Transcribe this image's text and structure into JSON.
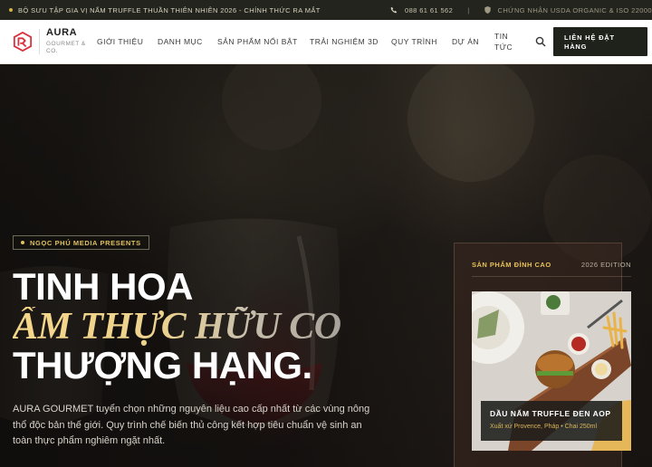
{
  "topbar": {
    "announcement": "BỘ SƯU TẬP GIA VỊ NẤM TRUFFLE THUẦN THIÊN NHIÊN 2026 - CHÍNH THỨC RA MẮT",
    "phone": "088 61 61 562",
    "separator": "|",
    "certification": "CHỨNG NHẬN USDA ORGANIC & ISO 22000"
  },
  "logo": {
    "name": "AURA",
    "sub": "GOURMET & CO."
  },
  "nav": {
    "items": [
      {
        "label": "GIỚI THIỆU"
      },
      {
        "label": "DANH MỤC"
      },
      {
        "label": "SẢN PHẨM NỔI BẬT"
      },
      {
        "label": "TRẢI NGHIỆM 3D"
      },
      {
        "label": "QUY TRÌNH"
      },
      {
        "label": "DỰ ÁN"
      },
      {
        "label": "TIN TỨC"
      }
    ],
    "cta": "LIÊN HỆ ĐẶT HÀNG"
  },
  "hero": {
    "badge": "NGỌC PHÚ MEDIA PRESENTS",
    "line1": "TINH HOA",
    "line2": "ẨM THỰC HỮU CO",
    "line3": "THƯỢNG HẠNG.",
    "lead": "AURA GOURMET tuyển chọn những nguyên liệu cao cấp nhất từ các vùng nông thổ độc bản thế giới. Quy trình chế biến thủ công kết hợp tiêu chuẩn vệ sinh an toàn thực phẩm nghiêm ngặt nhất."
  },
  "card": {
    "title": "SẢN PHẨM ĐỈNH CAO",
    "edition": "2026 EDITION",
    "product": "DẦU NẤM TRUFFLE ĐEN AOP",
    "detail": "Xuất xứ Provence, Pháp • Chai 250ml"
  },
  "colors": {
    "accent": "#e0c060",
    "dark": "#1f211b"
  }
}
